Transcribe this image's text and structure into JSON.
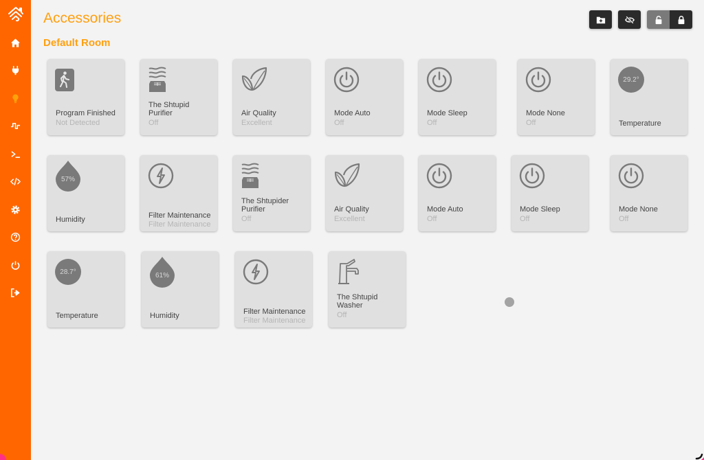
{
  "colors": {
    "sidebar": "#ff6600",
    "accent": "#ffa010",
    "tile_bg": "#e0e0e0",
    "icon_gray": "#7a7a7a"
  },
  "sidebar": {
    "logo": "homebridge-logo-icon",
    "items": [
      {
        "name": "home",
        "icon": "home-icon",
        "active": false
      },
      {
        "name": "plugins",
        "icon": "plug-icon",
        "active": false
      },
      {
        "name": "accessories",
        "icon": "lightbulb-icon",
        "active": true
      },
      {
        "name": "status",
        "icon": "pulse-icon",
        "active": false
      },
      {
        "name": "terminal",
        "icon": "terminal-icon",
        "active": false
      },
      {
        "name": "config",
        "icon": "code-icon",
        "active": false
      },
      {
        "name": "settings",
        "icon": "gear-icon",
        "active": false
      },
      {
        "name": "help",
        "icon": "help-icon",
        "active": false
      },
      {
        "name": "power",
        "icon": "power-icon",
        "active": false
      },
      {
        "name": "logout",
        "icon": "logout-icon",
        "active": false
      }
    ]
  },
  "header": {
    "title": "Accessories",
    "toolbar": [
      {
        "name": "add-room",
        "icon": "folder-plus-icon"
      },
      {
        "name": "hide",
        "icon": "eye-slash-icon"
      },
      {
        "name": "unlock",
        "icon": "unlock-icon",
        "state": "inactive"
      },
      {
        "name": "lock",
        "icon": "lock-icon",
        "state": "active"
      }
    ]
  },
  "room": {
    "title": "Default Room",
    "tiles": [
      {
        "name": "Program Finished",
        "status": "Not Detected",
        "icon": "motion-sensor-icon"
      },
      {
        "name": "The Shtupid Purifier",
        "status": "Off",
        "icon": "air-purifier-icon"
      },
      {
        "name": "Air Quality",
        "status": "Excellent",
        "icon": "leaf-icon"
      },
      {
        "name": "Mode Auto",
        "status": "Off",
        "icon": "power-icon"
      },
      {
        "name": "Mode Sleep",
        "status": "Off",
        "icon": "power-icon"
      },
      {
        "name": "Mode None",
        "status": "Off",
        "icon": "power-icon"
      },
      {
        "name": "Temperature",
        "status": "",
        "icon": "temperature-badge",
        "value": "29.2°"
      },
      {
        "name": "Humidity",
        "status": "",
        "icon": "humidity-drop",
        "value": "57%"
      },
      {
        "name": "Filter Maintenance",
        "status": "Filter Maintenance",
        "icon": "lightning-icon"
      },
      {
        "name": "The Shtupider Purifier",
        "status": "Off",
        "icon": "air-purifier-icon"
      },
      {
        "name": "Air Quality",
        "status": "Excellent",
        "icon": "leaf-icon"
      },
      {
        "name": "Mode Auto",
        "status": "Off",
        "icon": "power-icon"
      },
      {
        "name": "Mode Sleep",
        "status": "Off",
        "icon": "power-icon"
      },
      {
        "name": "Mode None",
        "status": "Off",
        "icon": "power-icon"
      },
      {
        "name": "Temperature",
        "status": "",
        "icon": "temperature-badge",
        "value": "28.7°"
      },
      {
        "name": "Humidity",
        "status": "",
        "icon": "humidity-drop",
        "value": "61%"
      },
      {
        "name": "Filter Maintenance",
        "status": "Filter Maintenance",
        "icon": "lightning-icon"
      },
      {
        "name": "The Shtupid Washer",
        "status": "Off",
        "icon": "faucet-icon"
      }
    ]
  }
}
